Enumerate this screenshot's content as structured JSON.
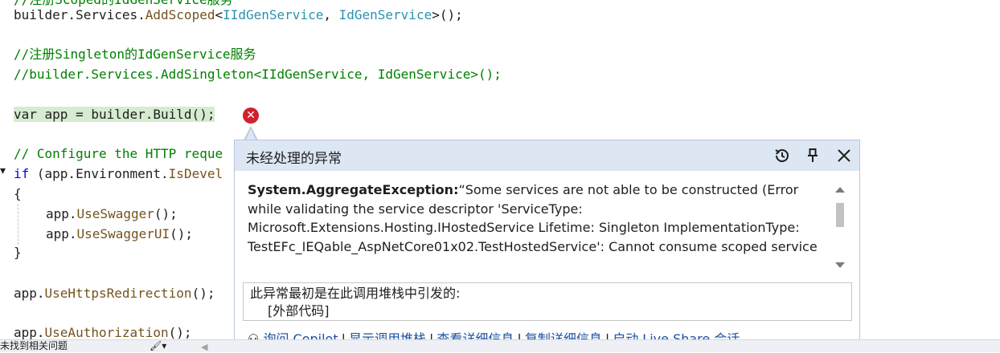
{
  "code": {
    "line_top_partial": "//注册Scoped的IdGenService服务",
    "line1": {
      "a": "builder.",
      "b": "Services",
      "c": ".",
      "d": "AddScoped",
      "e": "<",
      "f": "IIdGenService",
      "g": ", ",
      "h": "IdGenService",
      "i": ">();"
    },
    "comment_singleton": "//注册Singleton的IdGenService服务",
    "comment_singleton_code": "//builder.Services.AddSingleton<IIdGenService, IdGenService>();",
    "build_line": "var app = builder.Build();",
    "comment_configure": "// Configure the HTTP reque",
    "if_line": {
      "kw": "if",
      "a": " (app.",
      "b": "Environment",
      "c": ".",
      "d": "IsDevel"
    },
    "open_brace": "{",
    "swagger": {
      "a": "app.",
      "b": "UseSwagger",
      "c": "();"
    },
    "swagger_ui": {
      "a": "app.",
      "b": "UseSwaggerUI",
      "c": "();"
    },
    "close_brace": "}",
    "https": {
      "a": "app.",
      "b": "UseHttpsRedirection",
      "c": "();"
    },
    "auth": {
      "a": "app.",
      "b": "UseAuthorization",
      "c": "();"
    }
  },
  "exception_popup": {
    "title": "未经处理的异常",
    "exception_type": "System.AggregateException:",
    "message": "“Some services are not able to be constructed (Error while validating the service descriptor 'ServiceType: Microsoft.Extensions.Hosting.IHostedService Lifetime: Singleton ImplementationType: TestEFc_IEQable_AspNetCore01x02.TestHostedService': Cannot consume scoped service",
    "stack_origin": "此异常最初是在此调用堆栈中引发的:",
    "stack_external": "[外部代码]",
    "links": [
      "询问 Copilot",
      "显示调用堆栈",
      "查看详细信息",
      "复制详细信息",
      "启动 Live Share 会话..."
    ]
  },
  "statusbar": {
    "text": "未找到相关问题"
  },
  "colors": {
    "error_red": "#d1202e",
    "popup_header": "#dde6f3",
    "line_highlight": "#d6ebd0",
    "comment": "#008000",
    "type": "#2b91af",
    "method": "#74531f",
    "keyword": "#0000ff"
  },
  "icons": [
    "error-icon",
    "history-icon",
    "pin-icon",
    "close-icon",
    "copilot-icon",
    "brush-icon"
  ]
}
